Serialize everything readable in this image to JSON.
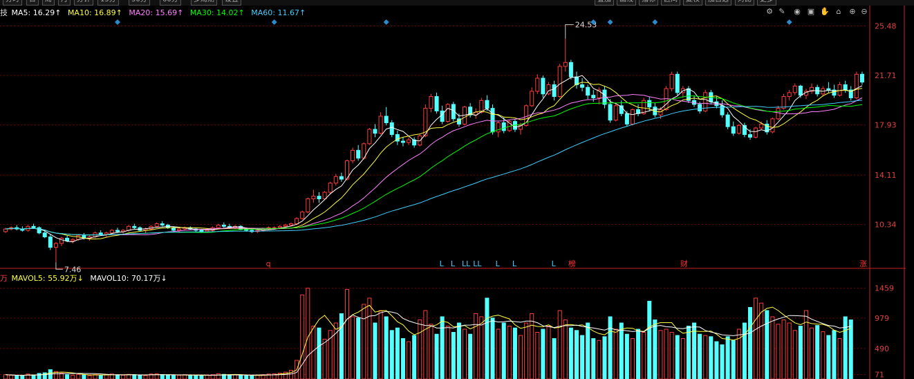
{
  "tabs": [
    "分时",
    "日",
    "周",
    "月",
    "分钟",
    "15分",
    "30分",
    "60分",
    "多周期",
    "设置"
  ],
  "right_tabs": [
    "叠加",
    "画线",
    "指标",
    "区间",
    "复权",
    "加自选",
    "对比",
    "更多"
  ],
  "main_legend": {
    "prefix": "技",
    "ma5": "MA5: 16.29↑",
    "ma10": "MA10: 16.89↑",
    "ma20": "MA20: 15.69↑",
    "ma30": "MA30: 14.02↑",
    "ma60": "MA60: 11.67↑"
  },
  "vol_legend": {
    "prefix": "万",
    "mavol5": "MAVOL5: 55.92万↓",
    "mavol10": "MAVOL10: 70.17万↓"
  },
  "toolbar_icons": [
    "gear-icon",
    "pen-icon",
    "eye-icon",
    "hand-icon",
    "lock-icon",
    "zoom-in-icon",
    "zoom-out-icon"
  ],
  "colors": {
    "up": "#ff3c3c",
    "down": "#54ffff",
    "ma5": "#ffffff",
    "ma10": "#ffff40",
    "ma20": "#ff80ff",
    "ma30": "#00ff00",
    "ma60": "#40d0ff",
    "grid": "#7a0000",
    "axis": "#cc2222"
  },
  "chart_data": {
    "type": "candlestick",
    "price_axis": {
      "ticks": [
        "25.48",
        "21.71",
        "17.93",
        "14.11",
        "10.34"
      ],
      "range": [
        7.0,
        26.3
      ]
    },
    "volume_axis": {
      "ticks": [
        "1459",
        "979",
        "490",
        "71"
      ],
      "range": [
        0,
        1600
      ]
    },
    "annotations": {
      "high": "24.53",
      "low": "7.46"
    },
    "markers": [
      "q",
      "L",
      "L",
      "LL",
      "LL",
      "L",
      "L",
      "L",
      "榜",
      "财",
      "涨"
    ],
    "ohlc": [
      [
        9.8,
        10.1,
        9.7,
        10.0
      ],
      [
        10.0,
        10.2,
        9.9,
        10.1
      ],
      [
        10.1,
        10.3,
        9.9,
        10.0
      ],
      [
        10.0,
        10.2,
        9.8,
        9.9
      ],
      [
        9.9,
        10.3,
        9.8,
        10.2
      ],
      [
        10.2,
        10.4,
        10.0,
        10.1
      ],
      [
        10.1,
        10.2,
        9.6,
        9.7
      ],
      [
        9.7,
        9.9,
        9.3,
        9.4
      ],
      [
        9.4,
        9.6,
        8.4,
        8.6
      ],
      [
        8.6,
        9.0,
        7.46,
        8.9
      ],
      [
        8.9,
        9.4,
        8.7,
        9.3
      ],
      [
        9.3,
        9.5,
        9.0,
        9.1
      ],
      [
        9.1,
        9.3,
        8.9,
        9.2
      ],
      [
        9.2,
        9.6,
        9.1,
        9.5
      ],
      [
        9.5,
        9.7,
        9.2,
        9.3
      ],
      [
        9.3,
        9.5,
        9.1,
        9.4
      ],
      [
        9.4,
        9.8,
        9.3,
        9.7
      ],
      [
        9.7,
        9.9,
        9.5,
        9.6
      ],
      [
        9.6,
        9.8,
        9.4,
        9.7
      ],
      [
        9.7,
        10.0,
        9.6,
        9.9
      ],
      [
        9.9,
        10.1,
        9.7,
        9.8
      ],
      [
        9.8,
        10.0,
        9.6,
        9.9
      ],
      [
        9.9,
        10.3,
        9.8,
        10.2
      ],
      [
        10.2,
        10.4,
        10.0,
        10.1
      ],
      [
        10.1,
        10.2,
        9.8,
        9.9
      ],
      [
        9.9,
        10.1,
        9.7,
        10.0
      ],
      [
        10.0,
        10.3,
        9.9,
        10.2
      ],
      [
        10.2,
        10.5,
        10.1,
        10.4
      ],
      [
        10.4,
        10.6,
        10.2,
        10.3
      ],
      [
        10.3,
        10.4,
        10.0,
        10.1
      ],
      [
        10.1,
        10.2,
        9.8,
        9.9
      ],
      [
        9.9,
        10.1,
        9.7,
        10.0
      ],
      [
        10.0,
        10.2,
        9.9,
        10.1
      ],
      [
        10.1,
        10.2,
        9.9,
        10.0
      ],
      [
        10.0,
        10.1,
        9.8,
        9.9
      ],
      [
        9.9,
        10.0,
        9.7,
        9.8
      ],
      [
        9.8,
        10.0,
        9.7,
        9.9
      ],
      [
        9.9,
        10.2,
        9.8,
        10.1
      ],
      [
        10.1,
        10.4,
        10.0,
        10.3
      ],
      [
        10.3,
        10.5,
        10.1,
        10.2
      ],
      [
        10.2,
        10.4,
        10.0,
        10.1
      ],
      [
        10.1,
        10.3,
        10.0,
        10.2
      ],
      [
        10.2,
        10.3,
        9.9,
        10.0
      ],
      [
        10.0,
        10.1,
        9.8,
        9.9
      ],
      [
        9.9,
        10.0,
        9.7,
        9.8
      ],
      [
        9.8,
        10.0,
        9.7,
        9.9
      ],
      [
        9.9,
        10.1,
        9.8,
        10.0
      ],
      [
        10.0,
        10.2,
        9.9,
        10.1
      ],
      [
        10.1,
        10.2,
        10.0,
        10.1
      ],
      [
        10.1,
        10.3,
        10.0,
        10.2
      ],
      [
        10.2,
        10.4,
        10.1,
        10.3
      ],
      [
        10.3,
        10.5,
        10.2,
        10.4
      ],
      [
        10.4,
        10.9,
        10.3,
        10.8
      ],
      [
        10.8,
        11.4,
        10.7,
        11.3
      ],
      [
        11.3,
        12.4,
        11.2,
        12.3
      ],
      [
        12.3,
        13.0,
        12.0,
        12.5
      ],
      [
        12.5,
        12.8,
        12.0,
        12.3
      ],
      [
        12.3,
        12.9,
        12.2,
        12.8
      ],
      [
        12.8,
        13.6,
        12.7,
        13.5
      ],
      [
        13.5,
        14.2,
        13.3,
        14.0
      ],
      [
        14.0,
        14.3,
        13.6,
        13.8
      ],
      [
        13.8,
        15.3,
        13.7,
        15.2
      ],
      [
        15.2,
        16.2,
        15.0,
        16.0
      ],
      [
        16.0,
        16.4,
        15.2,
        15.4
      ],
      [
        15.4,
        16.6,
        15.3,
        16.5
      ],
      [
        16.5,
        17.7,
        16.4,
        17.6
      ],
      [
        17.6,
        18.0,
        17.0,
        17.3
      ],
      [
        17.3,
        18.9,
        17.2,
        18.6
      ],
      [
        18.6,
        19.3,
        17.9,
        18.1
      ],
      [
        18.1,
        18.3,
        17.0,
        17.2
      ],
      [
        17.2,
        17.5,
        16.4,
        16.7
      ],
      [
        16.7,
        17.0,
        16.3,
        16.6
      ],
      [
        16.6,
        17.0,
        16.4,
        16.8
      ],
      [
        16.8,
        17.0,
        16.2,
        16.4
      ],
      [
        16.4,
        17.2,
        16.3,
        17.1
      ],
      [
        17.1,
        19.5,
        17.0,
        19.2
      ],
      [
        19.2,
        20.3,
        18.9,
        20.1
      ],
      [
        20.1,
        20.4,
        18.8,
        19.0
      ],
      [
        19.0,
        19.4,
        18.0,
        18.2
      ],
      [
        18.2,
        19.6,
        18.1,
        19.5
      ],
      [
        19.5,
        19.7,
        18.2,
        18.4
      ],
      [
        18.4,
        18.8,
        17.8,
        18.0
      ],
      [
        18.0,
        19.4,
        17.9,
        19.3
      ],
      [
        19.3,
        19.6,
        18.5,
        18.7
      ],
      [
        18.7,
        19.2,
        18.4,
        18.9
      ],
      [
        18.9,
        20.0,
        18.8,
        19.8
      ],
      [
        19.8,
        20.2,
        19.0,
        19.2
      ],
      [
        19.2,
        19.5,
        17.2,
        17.4
      ],
      [
        17.4,
        18.2,
        17.0,
        18.1
      ],
      [
        18.1,
        18.5,
        17.3,
        17.5
      ],
      [
        17.5,
        18.3,
        17.4,
        18.2
      ],
      [
        18.2,
        18.4,
        17.4,
        17.6
      ],
      [
        17.6,
        18.1,
        17.2,
        17.9
      ],
      [
        17.9,
        19.5,
        17.8,
        19.4
      ],
      [
        19.4,
        20.8,
        19.3,
        20.5
      ],
      [
        20.5,
        21.8,
        20.3,
        21.5
      ],
      [
        21.5,
        21.7,
        20.0,
        20.3
      ],
      [
        20.3,
        21.2,
        20.2,
        21.0
      ],
      [
        21.0,
        21.3,
        19.8,
        20.1
      ],
      [
        20.1,
        22.6,
        20.0,
        22.4
      ],
      [
        22.4,
        24.53,
        22.0,
        22.7
      ],
      [
        22.7,
        22.9,
        21.4,
        21.6
      ],
      [
        21.6,
        22.0,
        20.7,
        21.0
      ],
      [
        21.0,
        21.5,
        20.5,
        20.8
      ],
      [
        20.8,
        21.0,
        19.9,
        20.2
      ],
      [
        20.2,
        20.6,
        19.7,
        20.0
      ],
      [
        20.0,
        20.8,
        19.5,
        20.6
      ],
      [
        20.6,
        20.9,
        19.2,
        19.5
      ],
      [
        19.5,
        19.9,
        18.1,
        18.3
      ],
      [
        18.3,
        19.6,
        18.2,
        19.4
      ],
      [
        19.4,
        19.8,
        18.6,
        18.8
      ],
      [
        18.8,
        19.0,
        17.8,
        18.0
      ],
      [
        18.0,
        19.2,
        17.9,
        19.1
      ],
      [
        19.1,
        19.5,
        18.6,
        18.8
      ],
      [
        18.8,
        20.0,
        18.7,
        19.8
      ],
      [
        19.8,
        20.1,
        19.0,
        19.3
      ],
      [
        19.3,
        19.6,
        18.5,
        18.7
      ],
      [
        18.7,
        19.3,
        18.4,
        19.1
      ],
      [
        19.1,
        20.9,
        19.0,
        20.7
      ],
      [
        20.7,
        22.0,
        20.5,
        21.8
      ],
      [
        21.8,
        22.0,
        20.2,
        20.4
      ],
      [
        20.4,
        20.9,
        20.0,
        20.7
      ],
      [
        20.7,
        20.9,
        19.6,
        19.8
      ],
      [
        19.8,
        20.2,
        19.3,
        19.5
      ],
      [
        19.5,
        19.7,
        18.8,
        19.0
      ],
      [
        19.0,
        20.6,
        18.9,
        20.4
      ],
      [
        20.4,
        20.6,
        19.5,
        19.7
      ],
      [
        19.7,
        20.1,
        19.2,
        19.4
      ],
      [
        19.4,
        19.8,
        18.5,
        18.7
      ],
      [
        18.7,
        18.9,
        17.6,
        17.8
      ],
      [
        17.8,
        18.2,
        17.1,
        17.3
      ],
      [
        17.3,
        18.0,
        17.2,
        17.9
      ],
      [
        17.9,
        18.1,
        17.0,
        17.2
      ],
      [
        17.2,
        17.6,
        16.8,
        17.0
      ],
      [
        17.0,
        17.8,
        16.9,
        17.7
      ],
      [
        17.7,
        18.2,
        17.6,
        18.0
      ],
      [
        18.0,
        18.3,
        17.2,
        17.4
      ],
      [
        17.4,
        18.5,
        17.3,
        18.4
      ],
      [
        18.4,
        19.4,
        18.3,
        19.2
      ],
      [
        19.2,
        20.3,
        19.1,
        20.1
      ],
      [
        20.1,
        20.6,
        19.8,
        20.4
      ],
      [
        20.4,
        21.1,
        20.2,
        20.9
      ],
      [
        20.9,
        21.0,
        20.0,
        20.2
      ],
      [
        20.2,
        20.7,
        19.9,
        20.5
      ],
      [
        20.5,
        21.1,
        20.3,
        20.8
      ],
      [
        20.8,
        21.0,
        20.1,
        20.3
      ],
      [
        20.3,
        20.9,
        20.1,
        20.7
      ],
      [
        20.7,
        21.2,
        20.4,
        20.6
      ],
      [
        20.6,
        21.0,
        20.0,
        20.2
      ],
      [
        20.2,
        21.2,
        20.1,
        21.0
      ],
      [
        21.0,
        21.3,
        20.4,
        20.6
      ],
      [
        20.6,
        20.9,
        19.8,
        20.0
      ],
      [
        20.0,
        22.0,
        19.9,
        21.8
      ],
      [
        21.8,
        22.0,
        21.0,
        21.2
      ]
    ],
    "volume_wan": [
      70,
      60,
      55,
      50,
      80,
      65,
      90,
      100,
      150,
      120,
      95,
      70,
      60,
      75,
      65,
      55,
      70,
      60,
      75,
      80,
      65,
      60,
      75,
      70,
      60,
      55,
      80,
      85,
      70,
      60,
      55,
      60,
      70,
      65,
      55,
      50,
      60,
      70,
      85,
      75,
      65,
      70,
      60,
      55,
      50,
      60,
      70,
      80,
      85,
      95,
      110,
      140,
      300,
      1350,
      1459,
      850,
      820,
      640,
      780,
      900,
      1050,
      1440,
      1000,
      980,
      1200,
      1300,
      900,
      1100,
      1000,
      780,
      820,
      650,
      600,
      700,
      950,
      1100,
      880,
      720,
      1000,
      850,
      750,
      900,
      800,
      720,
      1050,
      1000,
      1300,
      980,
      800,
      900,
      850,
      820,
      700,
      900,
      1050,
      750,
      800,
      850,
      650,
      1100,
      950,
      820,
      780,
      700,
      900,
      650,
      620,
      680,
      1000,
      800,
      900,
      720,
      650,
      800,
      750,
      1250,
      950,
      780,
      800,
      750,
      700,
      650,
      850,
      900,
      720,
      700,
      680,
      600,
      550,
      680,
      620,
      800,
      900,
      1150,
      1300,
      1220,
      1100,
      1000,
      880,
      950,
      900,
      780,
      850,
      1100,
      820,
      860,
      760,
      700,
      780,
      650,
      1000,
      950
    ]
  }
}
